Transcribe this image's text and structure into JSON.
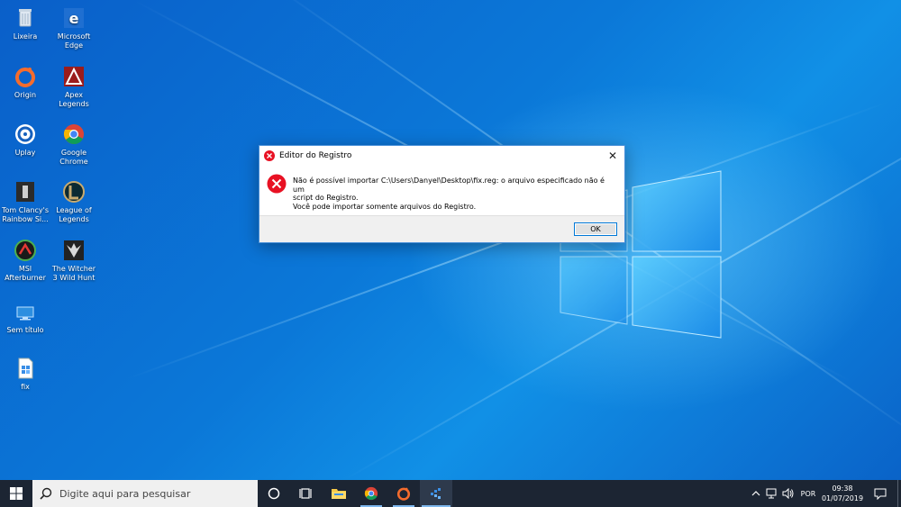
{
  "desktop": {
    "icons": [
      {
        "label": "Lixeira",
        "icon": "recycle-bin-icon"
      },
      {
        "label": "Microsoft\nEdge",
        "icon": "edge-icon"
      },
      {
        "label": "Origin",
        "icon": "origin-icon"
      },
      {
        "label": "Apex\nLegends",
        "icon": "apex-legends-icon"
      },
      {
        "label": "Uplay",
        "icon": "uplay-icon"
      },
      {
        "label": "Google\nChrome",
        "icon": "chrome-icon"
      },
      {
        "label": "Tom Clancy's\nRainbow Si...",
        "icon": "rainbow-six-icon"
      },
      {
        "label": "League of\nLegends",
        "icon": "league-of-legends-icon"
      },
      {
        "label": "MSI\nAfterburner",
        "icon": "msi-afterburner-icon"
      },
      {
        "label": "The Witcher\n3 Wild Hunt",
        "icon": "witcher-icon"
      },
      {
        "label": "Sem título",
        "icon": "rdp-file-icon"
      },
      {
        "label": "fix",
        "icon": "reg-file-icon"
      }
    ]
  },
  "dialog": {
    "title": "Editor do Registro",
    "message_line1": "Não é possível importar C:\\Users\\Danyel\\Desktop\\fix.reg: o arquivo especificado não é um",
    "message_line2": "script do Registro.",
    "message_line3": "Você pode importar somente arquivos do Registro.",
    "ok_label": "OK",
    "close_glyph": "✕",
    "icon": "error-icon"
  },
  "taskbar": {
    "search_placeholder": "Digite aqui para pesquisar",
    "apps": [
      "cortana-icon",
      "task-view-icon",
      "file-explorer-icon",
      "chrome-icon",
      "origin-icon",
      "regedit-icon"
    ],
    "language": "POR",
    "time": "09:38",
    "date": "01/07/2019"
  },
  "colors": {
    "accent": "#0078d7",
    "error": "#e81123",
    "taskbar": "#1c2533"
  }
}
